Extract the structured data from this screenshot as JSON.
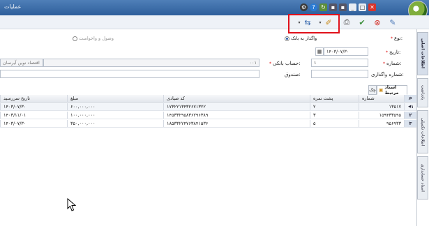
{
  "window": {
    "title": "عملیات"
  },
  "toolbar": {
    "icons": [
      "new-document-icon",
      "cancel-icon",
      "approve-icon",
      "print-icon",
      "edit-icon",
      "dropdown-icon",
      "bank-transfer-icon",
      "dropdown-icon"
    ]
  },
  "form": {
    "type_label": "نوع:",
    "radio_bank": "واگذار به بانک",
    "radio_return": "وصول و واخواست",
    "date_label": "تاریخ:",
    "date_value": "۱۴۰۳/۰۷/۳۰",
    "number_label": "شماره:",
    "number_value": "۱",
    "bank_account_label": "حساب بانکی:",
    "bank_account_value": "۰۰۱",
    "bank_name_value": "اقتصاد نوین آیرسان",
    "transfer_number_label": "شماره واگذاری:",
    "fund_label": "صندوق:"
  },
  "side_tabs": {
    "main": "اطلاعات اصلی",
    "notes": "یادداشت",
    "additional": "اطلاعات تکمیلی",
    "docs": "اسناد حسابداری"
  },
  "grid_tabs": {
    "related_docs": "اسناد مرتبط",
    "checks": "چک"
  },
  "grid": {
    "headers": [
      "شماره",
      "پشت نمره",
      "کد صیادی",
      "مبلغ",
      "تاریخ سررسید"
    ],
    "rows": [
      {
        "index": "۱",
        "cells": [
          "۱۳۵۱۷",
          "۲",
          "۱۷۳۲۲۱۳۴۳۲۶۷۱۳۲۲",
          "۶۰۰,۰۰۰,۰۰۰",
          "۱۴۰۳/۰۷/۳۰"
        ]
      },
      {
        "index": "۲",
        "cells": [
          "۱۵۹۴۳۳۵۹۵",
          "۳",
          "۱۴۵۳۳۲۹۵۸۳۶۲۹۶۳۸۹",
          "۱۰۰,۰۰۰,۰۰۰",
          "۱۴۰۳/۱۱/۰۱"
        ]
      },
      {
        "index": "۳",
        "cells": [
          "۹۵۶۹۳۳",
          "۵",
          "۱۸۵۳۳۲۲۴۷۶۳۸۴۱۵۳۶",
          "۳۵۰,۰۰۰,۰۰۰",
          "۱۴۰۳/۰۷/۳۰"
        ]
      }
    ]
  },
  "colors": {
    "titlebar": "#2e5f9b",
    "highlight": "#e0111b"
  }
}
